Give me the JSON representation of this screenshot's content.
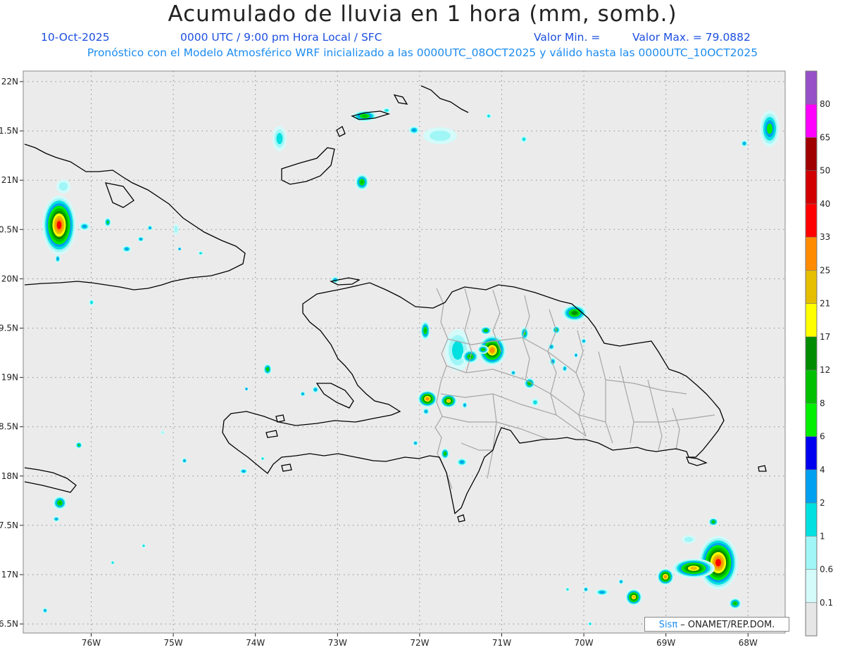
{
  "header": {
    "title": "Acumulado de lluvia en 1 hora (mm, somb.)",
    "date": "10-Oct-2025",
    "time": "0000 UTC / 9:00 pm Hora Local / SFC",
    "min_label": "Valor Min. =",
    "max_label": "Valor Max. = 79.0882",
    "model_line": "Pronóstico con el Modelo Atmosférico WRF inicializado a las 0000UTC_08OCT2025 y válido hasta las  0000UTC_10OCT2025"
  },
  "axes": {
    "lat_ticks": [
      "22N",
      "1.5N",
      "21N",
      "0.5N",
      "20N",
      "9.5N",
      "19N",
      "8.5N",
      "18N",
      "7.5N",
      "17N",
      "6.5N"
    ],
    "lon_ticks": [
      "76W",
      "75W",
      "74W",
      "73W",
      "72W",
      "71W",
      "70W",
      "69W",
      "68W"
    ],
    "lat_range": [
      16.5,
      22.1
    ],
    "lon_range": [
      -76.65,
      -67.62
    ]
  },
  "colorbar": {
    "labels": [
      "0.1",
      "0.6",
      "1",
      "2",
      "4",
      "6",
      "8",
      "12",
      "17",
      "21",
      "25",
      "33",
      "40",
      "50",
      "65",
      "80"
    ],
    "colors": [
      "#e6e6e6",
      "#d4fafa",
      "#a0f6f6",
      "#00e0e0",
      "#00a0f0",
      "#0000f0",
      "#00f000",
      "#00c000",
      "#008c00",
      "#ffff00",
      "#e6be00",
      "#ff8c00",
      "#ff0000",
      "#d20000",
      "#a00000",
      "#ff00ff",
      "#9650c8"
    ]
  },
  "map": {
    "background": "#ebebeb",
    "coast_color": "#000000",
    "border_color": "#a6a6a6"
  },
  "credit": {
    "brand": "Sisπ",
    "text": " – ONAMET/REP.DOM."
  }
}
